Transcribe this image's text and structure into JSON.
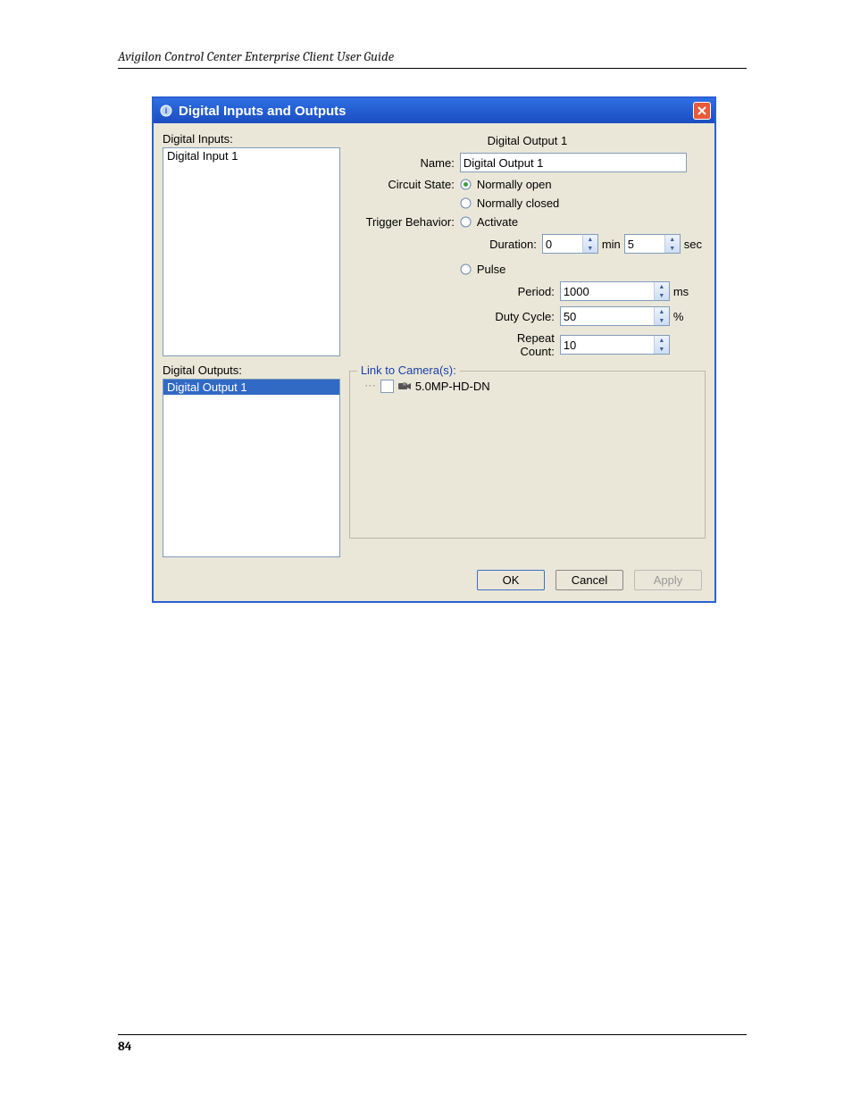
{
  "document": {
    "header": "Avigilon Control Center Enterprise Client User Guide",
    "page_number": "84"
  },
  "dialog": {
    "title": "Digital Inputs and Outputs",
    "left": {
      "inputs_label": "Digital Inputs:",
      "inputs_items": [
        "Digital Input 1"
      ],
      "outputs_label": "Digital Outputs:",
      "outputs_items": [
        "Digital Output 1"
      ],
      "outputs_selected_index": 0
    },
    "right": {
      "panel_title": "Digital Output 1",
      "name_label": "Name:",
      "name_value": "Digital Output 1",
      "circuit_label": "Circuit State:",
      "circuit_open": "Normally open",
      "circuit_closed": "Normally closed",
      "circuit_selected": "open",
      "trigger_label": "Trigger Behavior:",
      "activate_label": "Activate",
      "pulse_label": "Pulse",
      "trigger_selected": "none",
      "duration_label": "Duration:",
      "duration_min": "0",
      "min_unit": "min",
      "duration_sec": "5",
      "sec_unit": "sec",
      "period_label": "Period:",
      "period_value": "1000",
      "period_unit": "ms",
      "duty_label": "Duty Cycle:",
      "duty_value": "50",
      "duty_unit": "%",
      "repeat_label": "Repeat Count:",
      "repeat_value": "10",
      "link_legend": "Link to Camera(s):",
      "camera_name": "5.0MP-HD-DN"
    },
    "buttons": {
      "ok": "OK",
      "cancel": "Cancel",
      "apply": "Apply"
    }
  }
}
